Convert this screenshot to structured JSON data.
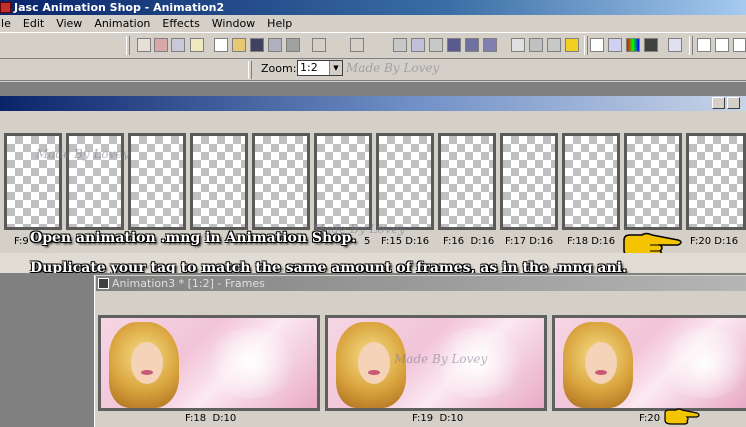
{
  "window": {
    "title": "Jasc Animation Shop - Animation2"
  },
  "menu": {
    "items": [
      "ile",
      "Edit",
      "View",
      "Animation",
      "Effects",
      "Window",
      "Help"
    ]
  },
  "toolbar": {
    "zoom_label": "Zoom:",
    "zoom_value": "1:2",
    "watermark": "Made By Lovey"
  },
  "top_frames": {
    "labels": [
      {
        "f": "F:9",
        "d": ""
      },
      {
        "f": "",
        "d": "5"
      },
      {
        "f": "F:15",
        "d": "D:16"
      },
      {
        "f": "F:16",
        "d": "D:16"
      },
      {
        "f": "F:17",
        "d": "D:16"
      },
      {
        "f": "F:18",
        "d": "D:16"
      },
      {
        "f": "F:20",
        "d": "D:16"
      }
    ],
    "watermark_1": "Made By Lovey",
    "watermark_2": "Made By Lovey"
  },
  "instructions": {
    "line1": "Open animation .mng in Animation Shop.",
    "line2": "Duplicate your tag to match the same amount of frames, as in the .mng ani."
  },
  "lower_window": {
    "title": "Animation3 * [1:2] - Frames",
    "frames": [
      {
        "f": "F:18",
        "d": "D:10"
      },
      {
        "f": "F:19",
        "d": "D:10"
      },
      {
        "f": "F:20",
        "d": ""
      }
    ],
    "watermark": "Made By Lovey"
  },
  "colors": {
    "title_active": "#0a246a",
    "hand": "#f5c400"
  }
}
